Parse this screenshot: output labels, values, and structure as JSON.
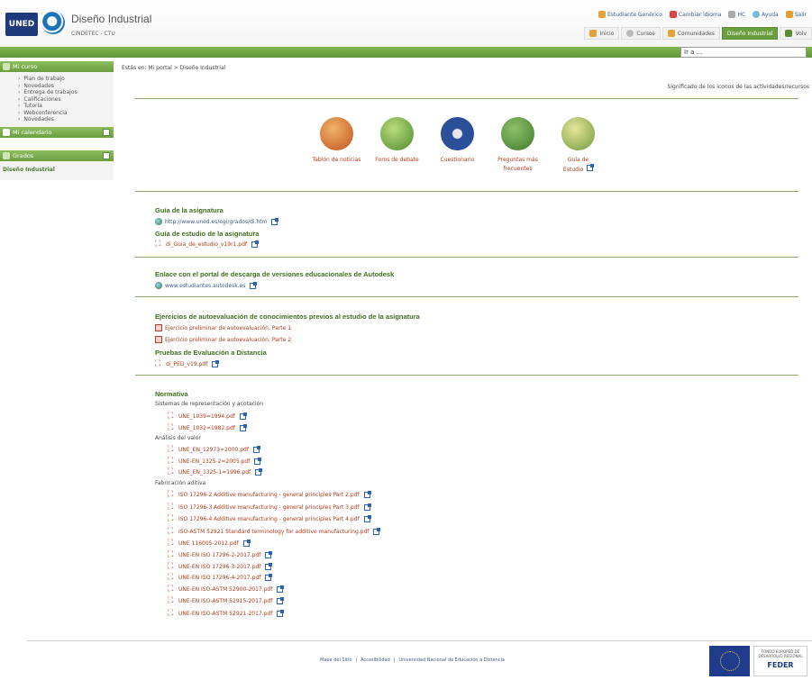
{
  "header": {
    "logo": "UNED",
    "title": "Diseño Industrial",
    "subtitle": "CINDETEC - CTU",
    "util": [
      {
        "label": "Estudiante Genérico",
        "icon": "user-icon"
      },
      {
        "label": "Cambiar idioma",
        "icon": "flag-icon"
      },
      {
        "label": "HC",
        "icon": "hc-icon"
      },
      {
        "label": "Ayuda",
        "icon": "help-icon"
      },
      {
        "label": "Salir",
        "icon": "exit-icon"
      }
    ],
    "tabs": [
      {
        "label": "Inicio",
        "icon": "home-icon",
        "active": false
      },
      {
        "label": "Cursos",
        "icon": "courses-icon",
        "active": false
      },
      {
        "label": "Comunidades",
        "icon": "communities-icon",
        "active": false
      },
      {
        "label": "Diseño Industrial",
        "icon": "",
        "active": true
      },
      {
        "label": "Volv",
        "icon": "back-icon",
        "active": false
      }
    ],
    "goto_value": "Ir a ..."
  },
  "sidebar": {
    "mi_curso": "Mi curso",
    "items": [
      "Plan de trabajo",
      "Novedades",
      "Entrega de trabajos",
      "Calificaciones",
      "Tutoría",
      "Webconferencia",
      "Novedades"
    ],
    "mi_calendario": "Mi calendario",
    "grados": "Grados",
    "grados_link": "Diseño Industrial"
  },
  "breadcrumb": {
    "prefix": "Estás en:",
    "path": "Mi portal > Diseño Industrial"
  },
  "icons_meaning": "Significado de los iconos de las actividades/recursos",
  "tools": [
    {
      "label": "Tablón de noticias",
      "icon": "news-board-icon",
      "color": "#d4622b"
    },
    {
      "label": "Foros de debate",
      "icon": "forum-icon",
      "color": "#6aa33b"
    },
    {
      "label": "Cuestionario",
      "icon": "quiz-icon",
      "color": "#2c4f9a"
    },
    {
      "label": "Preguntas más frecuentes",
      "icon": "faq-icon",
      "color": "#4f8f3c"
    },
    {
      "label": "Guía de Estudio",
      "icon": "study-guide-icon",
      "color": "#7aa04a"
    }
  ],
  "sections": {
    "guia_title": "Guía de la asignatura",
    "guia_link": "http://www.uned.es/egi/grados/di.htm",
    "guia_estudio_title": "Guía de estudio de la asignatura",
    "guia_estudio_file": "di_Guia_de_estudio_v19r1.pdf",
    "autodesk_title": "Enlace con el portal de descarga de versiones educacionales de Autodesk",
    "autodesk_link": "www.estudiantes.autodesk.es",
    "ejercicios_title": "Ejercicios de autoevaluación de conocimientos previos al estudio de la asignatura",
    "ejercicio1": "Ejercicio preliminar de autoevaluación. Parte 1",
    "ejercicio2": "Ejercicio preliminar de autoevaluación. Parte 2",
    "pruebas_title": "Pruebas de Evaluación a Distancia",
    "pruebas_file": "di_PED_v19.pdf",
    "normativa_title": "Normativa",
    "sub1": "Sistemas de representación y acotación",
    "sub1_files": [
      "UNE_1039=1994.pdf",
      "UNE_1032=1982.pdf"
    ],
    "sub2": "Análisis del valor",
    "sub2_files": [
      "UNE_EN_12973=2000.pdf",
      "UNE-EN_1325-2=2005.pdf",
      "UNE_EN_1325-1=1996.pdf"
    ],
    "sub3": "Fabricación aditiva",
    "sub3_files": [
      "ISO 17296-2 Additive manufacturing - general principles Part 2.pdf",
      "ISO 17296-3 Additive manufacturing - general principles Part 3.pdf",
      "ISO 17296-4 Additive manufacturing - general principles Part 4.pdf",
      "ISO-ASTM 52921 Standard terminology for additive manufacturing.pdf",
      "UNE 116005-2012.pdf",
      "UNE-EN ISO 17296-2-2017.pdf",
      "UNE-EN ISO 17296-3-2017.pdf",
      "UNE-EN ISO 17296-4-2017.pdf",
      "UNE-EN ISO-ASTM 52900-2017.pdf",
      "UNE-EN ISO-ASTM 52915-2017.pdf",
      "UNE-EN ISO-ASTM 52921-2017.pdf"
    ]
  },
  "footer": {
    "links": [
      "Mapa del Sitio",
      "Accesibilidad",
      "Universidad Nacional de Educación a Distancia"
    ],
    "separator": "|",
    "feder_small": "FONDO EUROPEO DE DESARROLLO REGIONAL",
    "feder_big": "FEDER"
  }
}
